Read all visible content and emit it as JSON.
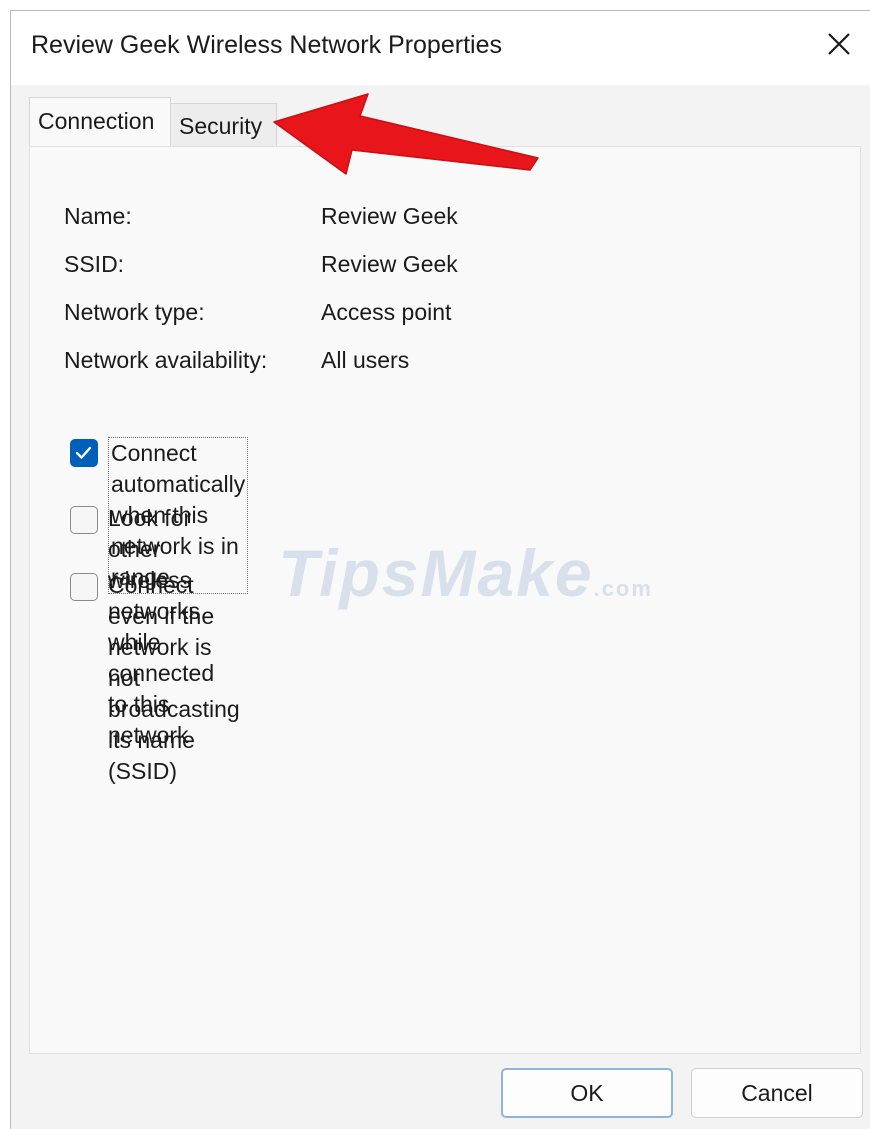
{
  "window": {
    "title": "Review Geek Wireless Network Properties"
  },
  "tabs": [
    {
      "label": "Connection",
      "selected": true
    },
    {
      "label": "Security",
      "selected": false
    }
  ],
  "properties": [
    {
      "label": "Name:",
      "value": "Review Geek"
    },
    {
      "label": "SSID:",
      "value": "Review Geek"
    },
    {
      "label": "Network type:",
      "value": "Access point"
    },
    {
      "label": "Network availability:",
      "value": "All users"
    }
  ],
  "options": [
    {
      "label": "Connect automatically when this network is in range",
      "checked": true
    },
    {
      "label_line1": "Look for other wireless networks while connected to this",
      "label_line2": "network",
      "checked": false
    },
    {
      "label_line1": "Connect even if the network is not broadcasting its name",
      "label_line2": "(SSID)",
      "checked": false
    }
  ],
  "buttons": {
    "ok": "OK",
    "cancel": "Cancel"
  },
  "watermark": {
    "text": "TipsMake",
    "suffix": ".com"
  },
  "colors": {
    "accent": "#005fb8",
    "annotation_arrow": "#e8161b"
  },
  "icons": {
    "close": "close-icon",
    "check": "checkmark-icon",
    "annotation": "arrow-pointer"
  }
}
